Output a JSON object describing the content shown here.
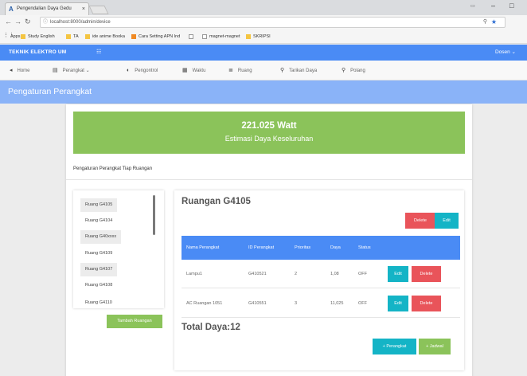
{
  "browser": {
    "tab_title": "Pengendalian Daya Gedu",
    "url": "localhost:8000/admin/device",
    "bookmarks": [
      {
        "label": "Apps",
        "icon": "apps-grid-icon"
      },
      {
        "label": "Study English",
        "icon": "folder-icon"
      },
      {
        "label": "TA",
        "icon": "folder-icon"
      },
      {
        "label": "ide anime Booka",
        "icon": "folder-icon"
      },
      {
        "label": "Cara Setting APN Ind",
        "icon": "bookmark-icon"
      },
      {
        "label": "",
        "icon": "page-icon"
      },
      {
        "label": "magnet-magnet",
        "icon": "page-icon"
      },
      {
        "label": "SKRIPSI",
        "icon": "folder-icon"
      }
    ]
  },
  "navbar": {
    "brand": "TEKNIK ELEKTRO UM",
    "toggle": "☷",
    "user": "Dosen ⌄"
  },
  "menu": [
    {
      "label": "Home",
      "icon": "◂"
    },
    {
      "label": "Perangkat ⌄",
      "icon": "▤"
    },
    {
      "label": "Pengontrol",
      "icon": "◐"
    },
    {
      "label": "Waktu",
      "icon": "▦"
    },
    {
      "label": "Ruang",
      "icon": "≣"
    },
    {
      "label": "Tarikan Daya",
      "icon": "⚲"
    },
    {
      "label": "Polang",
      "icon": "⚲"
    }
  ],
  "page": {
    "title": "Pengaturan Perangkat",
    "watt_value": "221.025 Watt",
    "watt_label": "Estimasi Daya Keseluruhan",
    "section_title": "Pengaturan Perangkat Tiap Ruangan"
  },
  "rooms": [
    "Ruang G4105",
    "Ruang G4104",
    "Ruang G40xxxx",
    "Ruang G4109",
    "Ruang G4107",
    "Ruang G4108",
    "Ruang G4110"
  ],
  "add_room_label": "Tambah Ruangan",
  "detail": {
    "room_title": "Ruangan G4105",
    "delete_label": "Delete",
    "edit_label": "Edit",
    "table_headers": [
      "Nama Perangkat",
      "ID Perangkat",
      "Prioritas",
      "Daya",
      "Status"
    ],
    "rows": [
      {
        "name": "Lampu1",
        "id": "G410521",
        "priority": "2",
        "power": "1,08",
        "status": "OFF"
      },
      {
        "name": "AC Ruangan 1051",
        "id": "G410551",
        "priority": "3",
        "power": "11,025",
        "status": "OFF"
      }
    ],
    "total_daya": "Total Daya:12",
    "add_device_label": "+ Perangkat",
    "add_schedule_label": "+ Jadwal"
  }
}
